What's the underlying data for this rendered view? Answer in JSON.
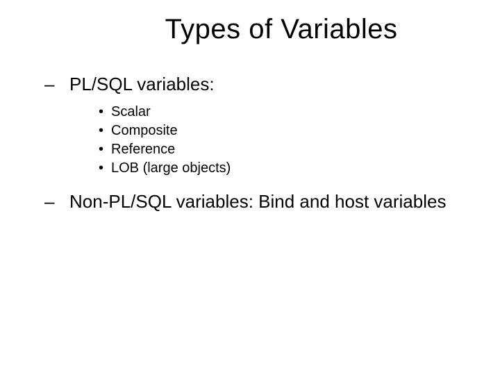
{
  "title": "Types of Variables",
  "dash": "–",
  "bullet": "•",
  "section1": {
    "heading": "PL/SQL variables:",
    "items": [
      "Scalar",
      "Composite",
      "Reference",
      "LOB (large objects)"
    ]
  },
  "section2": {
    "heading": "Non-PL/SQL variables: Bind and host variables"
  }
}
